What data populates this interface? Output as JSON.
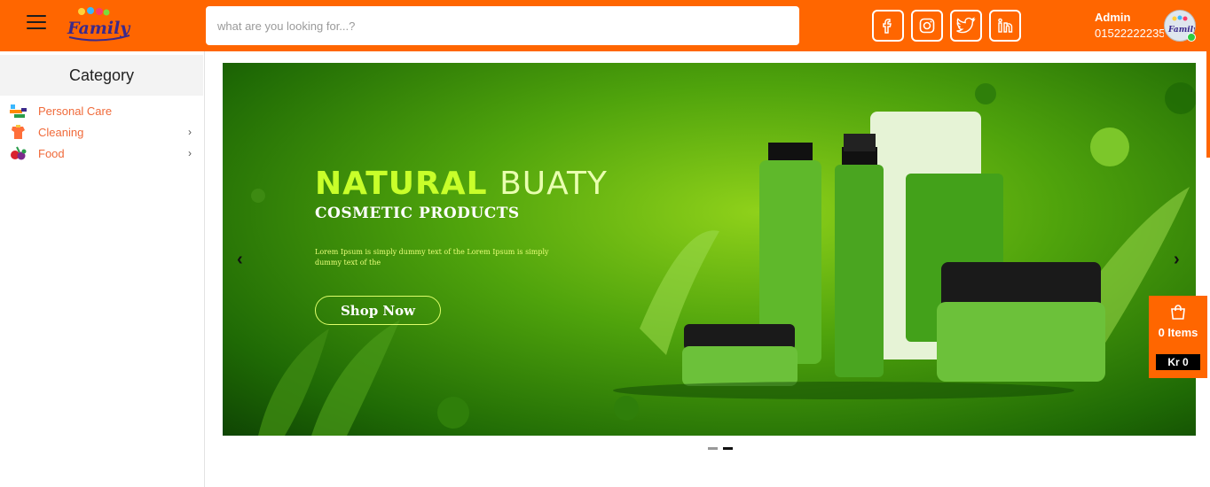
{
  "header": {
    "logo_text": "Family",
    "search_placeholder": "what are you looking for...?",
    "social": [
      "facebook-icon",
      "instagram-icon",
      "twitter-icon",
      "linkedin-icon"
    ],
    "user_name": "Admin",
    "user_phone": "01522222235",
    "accent": "#ff6600"
  },
  "sidebar": {
    "title": "Category",
    "items": [
      {
        "label": "Personal Care",
        "icon": "personal-care-icon",
        "has_submenu": false
      },
      {
        "label": "Cleaning",
        "icon": "cleaning-icon",
        "has_submenu": true
      },
      {
        "label": "Food",
        "icon": "food-icon",
        "has_submenu": true
      }
    ],
    "chevron": "›"
  },
  "banner": {
    "title_part1": "NATURAL",
    "title_part2": "BUATY",
    "subtitle": "COSMETIC PRODUCTS",
    "description": "Lorem Ipsum is simply dummy text of the  Lorem Ipsum is simply dummy text of the",
    "cta": "Shop Now",
    "prev": "‹",
    "next": "›",
    "slides_count": 2,
    "active_slide": 2
  },
  "cart": {
    "items_label": "0 Items",
    "total": "Kr 0"
  }
}
